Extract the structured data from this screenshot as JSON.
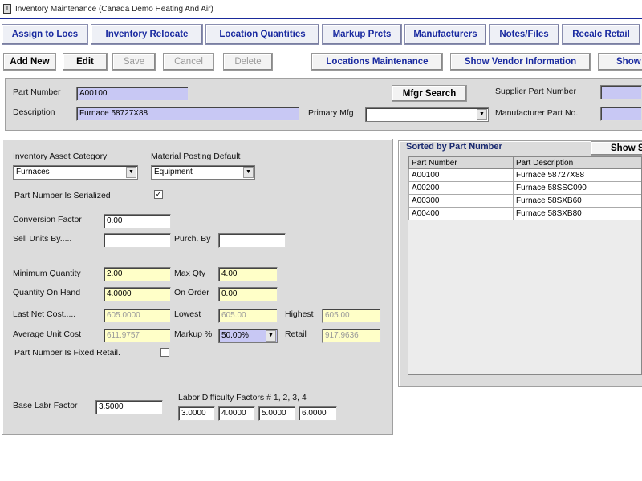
{
  "window": {
    "title": "Inventory Maintenance (Canada Demo Heating And Air)"
  },
  "tabs": [
    {
      "label": "Assign to Locs"
    },
    {
      "label": "Inventory Relocate"
    },
    {
      "label": "Location Quantities"
    },
    {
      "label": "Markup Prcts"
    },
    {
      "label": "Manufacturers"
    },
    {
      "label": "Notes/Files"
    },
    {
      "label": "Recalc Retail"
    }
  ],
  "toolbar": {
    "add_new": "Add New",
    "edit": "Edit",
    "save": "Save",
    "cancel": "Cancel",
    "delete": "Delete",
    "locations_maintenance": "Locations Maintenance",
    "show_vendor_information": "Show Vendor Information",
    "show_partial": "Show"
  },
  "header": {
    "part_number_label": "Part Number",
    "part_number_value": "A00100",
    "description_label": "Description",
    "description_value": "Furnace 58727X88",
    "mfgr_search": "Mfgr Search",
    "primary_mfg_label": "Primary Mfg",
    "primary_mfg_value": "",
    "supplier_part_number_label": "Supplier Part Number",
    "supplier_part_number_value": "",
    "manufacturer_part_no_label": "Manufacturer Part No.",
    "manufacturer_part_no_value": ""
  },
  "details": {
    "inventory_asset_category_label": "Inventory Asset Category",
    "inventory_asset_category_value": "Furnaces",
    "material_posting_default_label": "Material Posting Default",
    "material_posting_default_value": "Equipment",
    "part_number_is_serialized_label": "Part Number Is Serialized",
    "part_number_is_serialized_checked": "✓",
    "conversion_factor_label": "Conversion Factor",
    "conversion_factor_value": "0.00",
    "sell_units_by_label": "Sell Units By.....",
    "sell_units_by_value": "",
    "purch_by_label": "Purch. By",
    "purch_by_value": "",
    "minimum_quantity_label": "Minimum Quantity",
    "minimum_quantity_value": "2.00",
    "max_qty_label": "Max Qty",
    "max_qty_value": "4.00",
    "quantity_on_hand_label": "Quantity On Hand",
    "quantity_on_hand_value": "4.0000",
    "on_order_label": "On Order",
    "on_order_value": "0.00",
    "last_net_cost_label": "Last Net Cost.....",
    "last_net_cost_value": "605.0000",
    "lowest_label": "Lowest",
    "lowest_value": "605.00",
    "highest_label": "Highest",
    "highest_value": "605.00",
    "average_unit_cost_label": "Average Unit Cost",
    "average_unit_cost_value": "611.9757",
    "markup_label": "Markup %",
    "markup_value": "50.00%",
    "retail_label": "Retail",
    "retail_value": "917.9636",
    "part_number_is_fixed_retail_label": "Part Number Is Fixed Retail.",
    "base_labr_factor_label": "Base Labr Factor",
    "base_labr_factor_value": "3.5000",
    "labor_difficulty_label": "Labor Difficulty Factors # 1, 2, 3, 4",
    "labor_factors": [
      "3.0000",
      "4.0000",
      "5.0000",
      "6.0000"
    ]
  },
  "sorted_list": {
    "title": "Sorted by Part Number",
    "show_partial": "Show Se",
    "columns": [
      "Part Number",
      "Part Description"
    ],
    "rows": [
      [
        "A00100",
        "Furnace 58727X88"
      ],
      [
        "A00200",
        "Furnace 58SSC090"
      ],
      [
        "A00300",
        "Furnace 58SXB60"
      ],
      [
        "A00400",
        "Furnace 58SXB80"
      ]
    ]
  }
}
